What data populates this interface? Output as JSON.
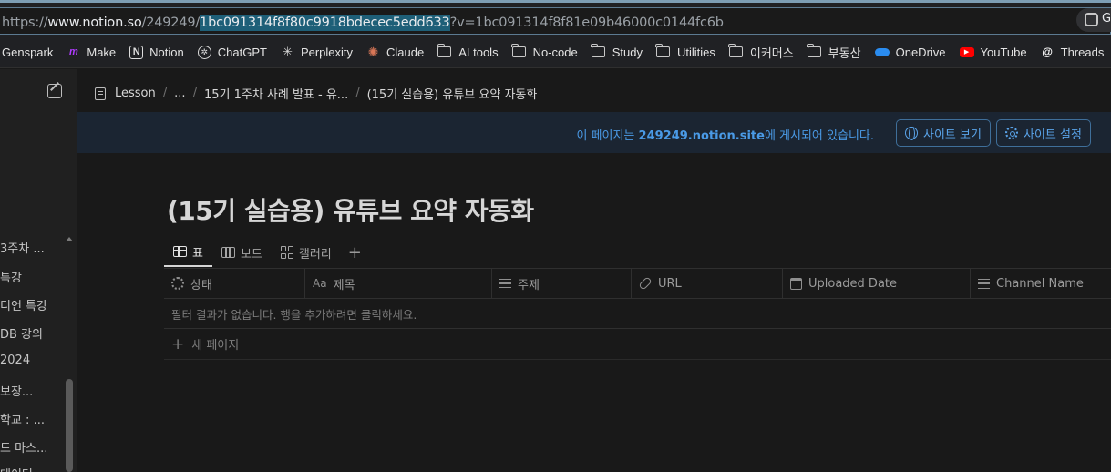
{
  "browser": {
    "url_prefix": "https://",
    "url_host": "www.notion.so",
    "url_path": "/249249/",
    "url_selected": "1bc091314f8f80c9918bdecec5edd633",
    "url_query": "?v=1bc091314f8f81e09b46000c0144fc6b",
    "right_label": "G"
  },
  "bookmarks": [
    {
      "label": "Genspark",
      "icon": "genspark-icon"
    },
    {
      "label": "Make",
      "icon": "make-icon"
    },
    {
      "label": "Notion",
      "icon": "notion-icon"
    },
    {
      "label": "ChatGPT",
      "icon": "chatgpt-icon"
    },
    {
      "label": "Perplexity",
      "icon": "perplexity-icon"
    },
    {
      "label": "Claude",
      "icon": "claude-icon"
    },
    {
      "label": "AI tools",
      "icon": "folder-icon"
    },
    {
      "label": "No-code",
      "icon": "folder-icon"
    },
    {
      "label": "Study",
      "icon": "folder-icon"
    },
    {
      "label": "Utilities",
      "icon": "folder-icon"
    },
    {
      "label": "이커머스",
      "icon": "folder-icon"
    },
    {
      "label": "부동산",
      "icon": "folder-icon"
    },
    {
      "label": "OneDrive",
      "icon": "onedrive-icon"
    },
    {
      "label": "YouTube",
      "icon": "youtube-icon"
    },
    {
      "label": "Threads",
      "icon": "threads-icon"
    }
  ],
  "sidebar": {
    "items": [
      {
        "label": "3주차 ..."
      },
      {
        "label": "특강"
      },
      {
        "label": "디언 특강"
      },
      {
        "label": "DB 강의"
      },
      {
        "label": "2024"
      },
      {
        "label": "보장..."
      },
      {
        "label": "학교 : ..."
      },
      {
        "label": "드 마스..."
      },
      {
        "label": "데이터"
      }
    ]
  },
  "breadcrumb": {
    "items": [
      "Lesson",
      "...",
      "15기 1주차 사례 발표 - 유...",
      "(15기 실습용) 유튜브 요약 자동화"
    ],
    "separator": "/"
  },
  "banner": {
    "text_prefix": "이 페이지는 ",
    "site": "249249.notion.site",
    "text_suffix": "에 게시되어 있습니다.",
    "view_site_label": "사이트 보기",
    "site_settings_label": "사이트 설정",
    "accent_color": "#4a9ae6"
  },
  "page": {
    "title": "(15기 실습용) 유튜브 요약 자동화"
  },
  "views": {
    "tabs": [
      {
        "label": "표",
        "icon": "table-icon",
        "active": true
      },
      {
        "label": "보드",
        "icon": "board-icon",
        "active": false
      },
      {
        "label": "갤러리",
        "icon": "gallery-icon",
        "active": false
      }
    ],
    "add_label": "+"
  },
  "table": {
    "columns": [
      {
        "label": "상태",
        "icon": "status-icon"
      },
      {
        "label": "제목",
        "icon": "Aa"
      },
      {
        "label": "주제",
        "icon": "list-icon"
      },
      {
        "label": "URL",
        "icon": "link-icon"
      },
      {
        "label": "Uploaded Date",
        "icon": "calendar-icon"
      },
      {
        "label": "Channel Name",
        "icon": "text-icon"
      }
    ],
    "empty_message": "필터 결과가 없습니다. 행을 추가하려면 클릭하세요.",
    "new_page_label": "새 페이지"
  }
}
